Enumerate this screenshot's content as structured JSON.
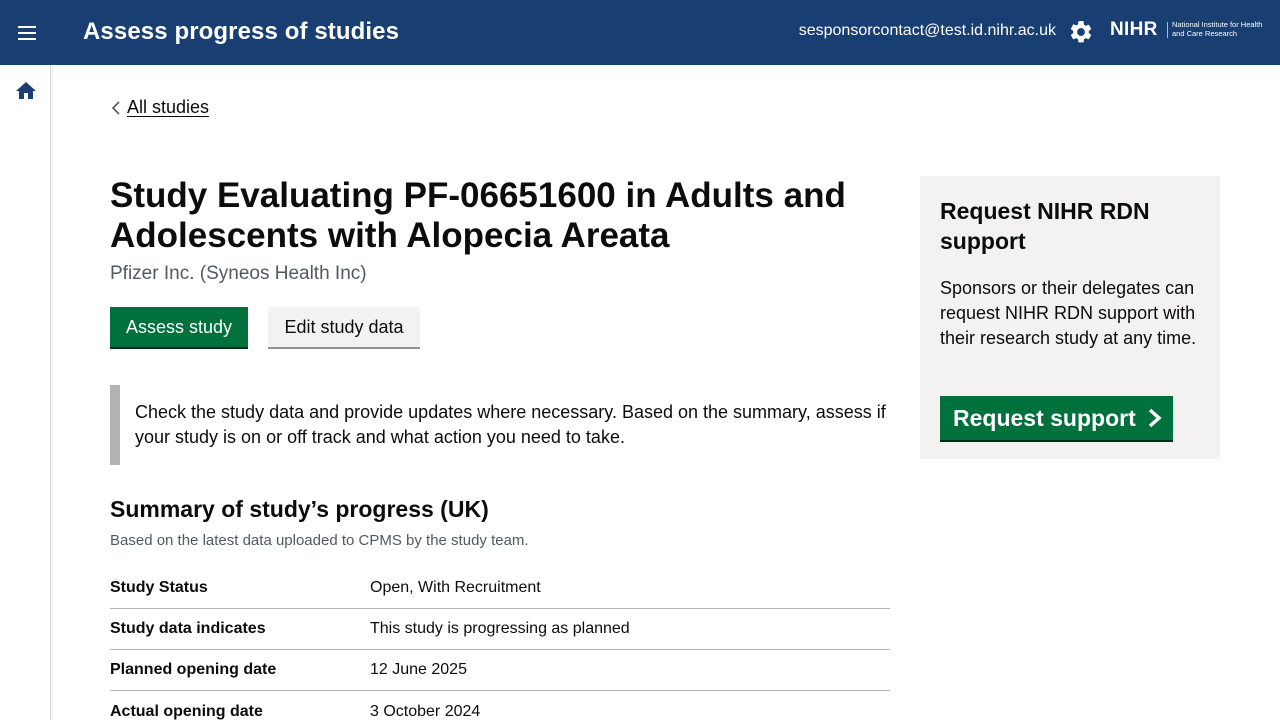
{
  "header": {
    "app_title": "Assess progress of studies",
    "user_email": "sesponsorcontact@test.id.nihr.ac.uk",
    "logo_text": "NIHR",
    "logo_subtext": "National Institute for Health and Care Research",
    "menu_icon": "hamburger-menu-icon",
    "settings_icon": "gear-icon",
    "background_color": "#193e72"
  },
  "sidebar": {
    "home_icon": "home-icon"
  },
  "breadcrumb": {
    "back_label": "All studies"
  },
  "study": {
    "title": "Study Evaluating PF-06651600 in Adults and Adolescents with Alopecia Areata",
    "sponsor": "Pfizer Inc. (Syneos Health Inc)",
    "assess_button": "Assess study",
    "edit_button": "Edit study data",
    "primary_color": "#00703c"
  },
  "inset_text": "Check the study data and provide updates where necessary. Based on the summary, assess if your study is on or off track and what action you need to take.",
  "summary": {
    "heading": "Summary of study’s progress (UK)",
    "caption": "Based on the latest data uploaded to CPMS by the study team.",
    "rows": [
      {
        "key": "Study Status",
        "value": "Open, With Recruitment"
      },
      {
        "key": "Study data indicates",
        "value": "This study is progressing as planned"
      },
      {
        "key": "Planned opening date",
        "value": "12 June 2025"
      },
      {
        "key": "Actual opening date",
        "value": "3 October 2024"
      }
    ]
  },
  "support_panel": {
    "title": "Request NIHR RDN support",
    "body": "Sponsors or their delegates can request NIHR RDN support with their research study at any time.",
    "button_label": "Request support"
  }
}
